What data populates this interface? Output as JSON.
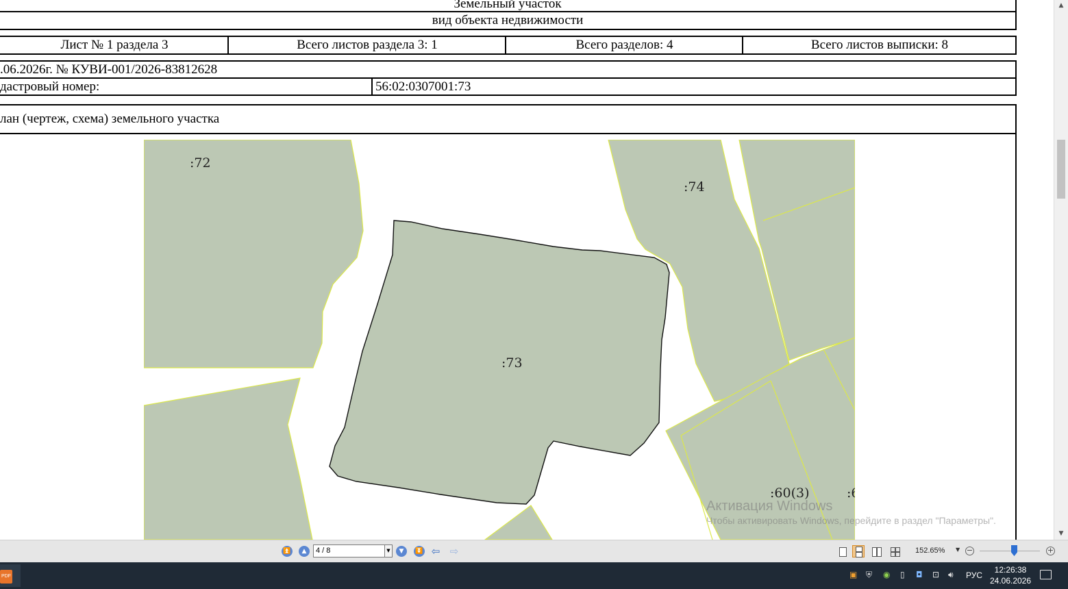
{
  "document": {
    "header_title": "Земельный участок",
    "header_subtitle": "вид объекта недвижимости",
    "sheet_info": [
      "Лист № 1 раздела 3",
      "Всего листов раздела 3: 1",
      "Всего разделов: 4",
      "Всего листов выписки: 8"
    ],
    "date_number": ".06.2026г. № КУВИ-001/2026-83812628",
    "cadastral_label": "дастровый номер:",
    "cadastral_value": "56:02:0307001:73",
    "plan_title": "лан (чертеж, схема) земельного участка"
  },
  "plan": {
    "parcel_labels": [
      ":72",
      ":74",
      ":73",
      ":60(3)",
      ":6"
    ],
    "colors": {
      "parcel_fill": "#bcc8b4",
      "neighbor_border": "#dce84a",
      "subject_border": "#000000"
    }
  },
  "watermark": {
    "line1": "Активация Windows",
    "line2": "Чтобы активировать Windows, перейдите в раздел \"Параметры\"."
  },
  "toolbar": {
    "page_value": "4 / 8",
    "zoom": "152.65%",
    "zoom_level_percent": 60
  },
  "taskbar": {
    "app_badge": "PDF",
    "language": "РУС",
    "time": "12:26:38",
    "date": "24.06.2026"
  }
}
